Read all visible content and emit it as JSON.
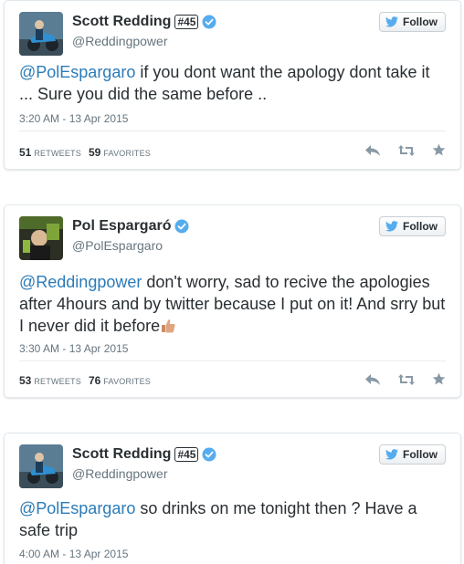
{
  "colors": {
    "accent": "#2b7bb9",
    "text": "#292f33",
    "muted": "#66757f",
    "verified": "#55acee"
  },
  "follow_label": "Follow",
  "tweets": [
    {
      "name": "Scott Redding",
      "name_badge": "#45",
      "handle": "@Reddingpower",
      "mention": "@PolEspargaro",
      "body": " if you dont want the apology dont take it ... Sure you did the same before ..",
      "time": "3:20 AM - 13 Apr 2015",
      "retweets": "51",
      "retweets_label": "Retweets",
      "favorites": "59",
      "favorites_label": "Favorites"
    },
    {
      "name": "Pol Espargaró",
      "handle": "@PolEspargaro",
      "mention": "@Reddingpower",
      "body": " don't worry, sad to recive the apologies after 4hours and by twitter because I put on it! And srry but I never did it before",
      "emoji": "thumbs-up-emoji",
      "time": "3:30 AM - 13 Apr 2015",
      "retweets": "53",
      "retweets_label": "Retweets",
      "favorites": "76",
      "favorites_label": "Favorites"
    },
    {
      "name": "Scott Redding",
      "name_badge": "#45",
      "handle": "@Reddingpower",
      "mention": "@PolEspargaro",
      "body": " so drinks on me tonight then ? Have a safe trip",
      "time": "4:00 AM - 13 Apr 2015"
    }
  ],
  "icons": {
    "verified": "verified-badge-icon",
    "follow": "twitter-bird-icon",
    "reply": "reply-icon",
    "retweet": "retweet-icon",
    "favorite": "star-icon"
  }
}
